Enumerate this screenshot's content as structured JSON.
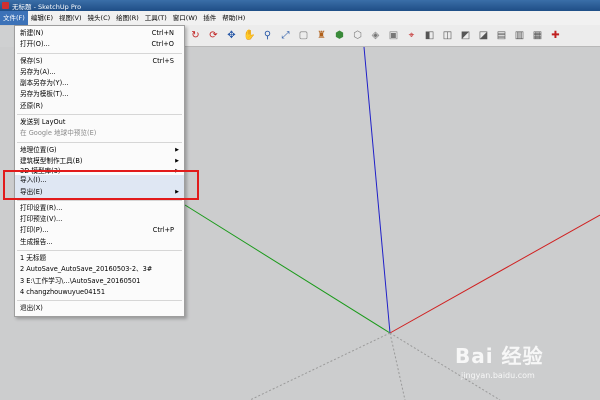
{
  "window": {
    "title": "无标题 - SketchUp Pro"
  },
  "menubar": [
    "文件(F)",
    "编辑(E)",
    "视图(V)",
    "镜头(C)",
    "绘图(R)",
    "工具(T)",
    "窗口(W)",
    "插件",
    "帮助(H)"
  ],
  "file_menu": {
    "new": {
      "label": "新建(N)",
      "shortcut": "Ctrl+N"
    },
    "open": {
      "label": "打开(O)...",
      "shortcut": "Ctrl+O"
    },
    "save": {
      "label": "保存(S)",
      "shortcut": "Ctrl+S"
    },
    "save_as": {
      "label": "另存为(A)..."
    },
    "save_copy_as": {
      "label": "副本另存为(Y)..."
    },
    "save_as_template": {
      "label": "另存为模板(T)..."
    },
    "revert": {
      "label": "还原(R)"
    },
    "send_to_layout": {
      "label": "发送到 LayOut"
    },
    "preview_google_earth": {
      "label": "在 Google 地球中预览(E)"
    },
    "geo_location": {
      "label": "地理位置(G)"
    },
    "building_maker": {
      "label": "建筑模型制作工具(B)"
    },
    "model_3d": {
      "label": "3D 模型库(3)"
    },
    "import": {
      "label": "导入(I)..."
    },
    "export": {
      "label": "导出(E)"
    },
    "print_setup": {
      "label": "打印设置(R)..."
    },
    "print_preview": {
      "label": "打印预览(V)..."
    },
    "print": {
      "label": "打印(P)...",
      "shortcut": "Ctrl+P"
    },
    "generate_report": {
      "label": "生成报告..."
    },
    "recent": [
      "1 无标题",
      "2 AutoSave_AutoSave_20160503-2、3#",
      "3 E:\\工作学习\\...\\AutoSave_20160501",
      "4 changzhouwuyue04151"
    ],
    "exit": {
      "label": "退出(X)"
    }
  },
  "toolbar_icons": [
    "rotate-icon",
    "refresh-icon",
    "orbit-icon",
    "pan-icon",
    "zoom-icon",
    "zoom-extents-icon",
    "view-icon",
    "paint-icon",
    "iso-icon",
    "view-icon",
    "view-icon",
    "view-icon",
    "section-icon",
    "xray-icon",
    "view-icon",
    "view-icon",
    "view-icon",
    "view-icon",
    "view-icon",
    "view-icon",
    "axes-icon"
  ],
  "watermark": {
    "logo": "Bai 经验",
    "url": "jingyan.baidu.com"
  },
  "colors": {
    "axis_blue": "#2020c8",
    "axis_red": "#d02020",
    "axis_green": "#1a9a1a",
    "highlight": "#e21b1b",
    "menu_active": "#3c72b8"
  }
}
